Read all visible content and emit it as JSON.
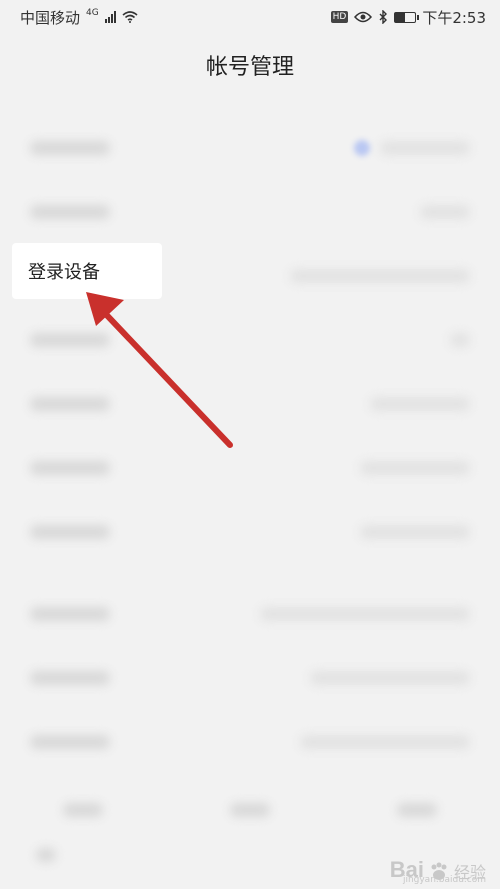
{
  "status_bar": {
    "carrier": "中国移动",
    "network": "4G",
    "time": "下午2:53",
    "hd": "HD",
    "battery_level": 0.5
  },
  "header": {
    "title": "帐号管理"
  },
  "highlight": {
    "label": "登录设备"
  },
  "icons": {
    "signal": "signal-icon",
    "wifi": "wifi-icon",
    "eye": "eye-icon",
    "bluetooth": "bluetooth-icon",
    "battery": "battery-icon"
  },
  "colors": {
    "arrow": "#c9302c",
    "background": "#f2f2f2"
  },
  "watermark": {
    "logo": "Bai",
    "suffix": "经验",
    "url": "jingyan.baidu.com"
  }
}
